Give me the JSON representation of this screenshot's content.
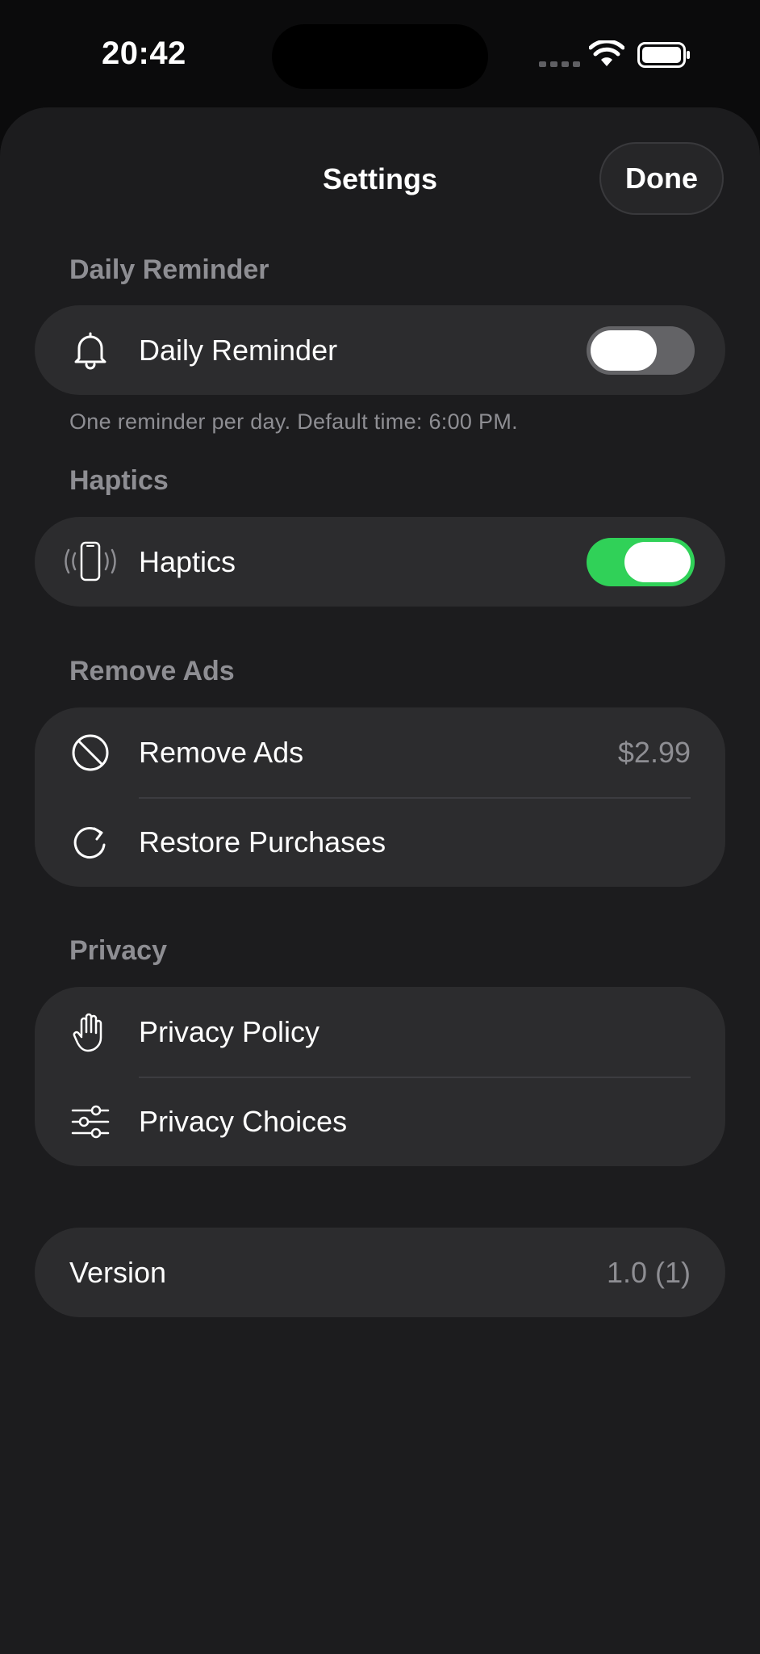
{
  "status_bar": {
    "time": "20:42"
  },
  "nav": {
    "title": "Settings",
    "done_label": "Done"
  },
  "sections": {
    "reminder": {
      "header": "Daily Reminder",
      "row_label": "Daily Reminder",
      "icon": "bell-icon",
      "toggle_on": false,
      "footnote": "One reminder per day. Default time: 6:00 PM."
    },
    "haptics": {
      "header": "Haptics",
      "row_label": "Haptics",
      "icon": "phone-vibrate-icon",
      "toggle_on": true
    },
    "ads": {
      "header": "Remove Ads",
      "remove_label": "Remove Ads",
      "remove_price": "$2.99",
      "restore_label": "Restore Purchases"
    },
    "privacy": {
      "header": "Privacy",
      "policy_label": "Privacy Policy",
      "choices_label": "Privacy Choices"
    },
    "version": {
      "label": "Version",
      "value": "1.0 (1)"
    }
  },
  "colors": {
    "background": "#1c1c1e",
    "card": "#2c2c2e",
    "secondary_text": "#8e8e93",
    "toggle_on": "#30d158",
    "toggle_off": "#636366"
  }
}
